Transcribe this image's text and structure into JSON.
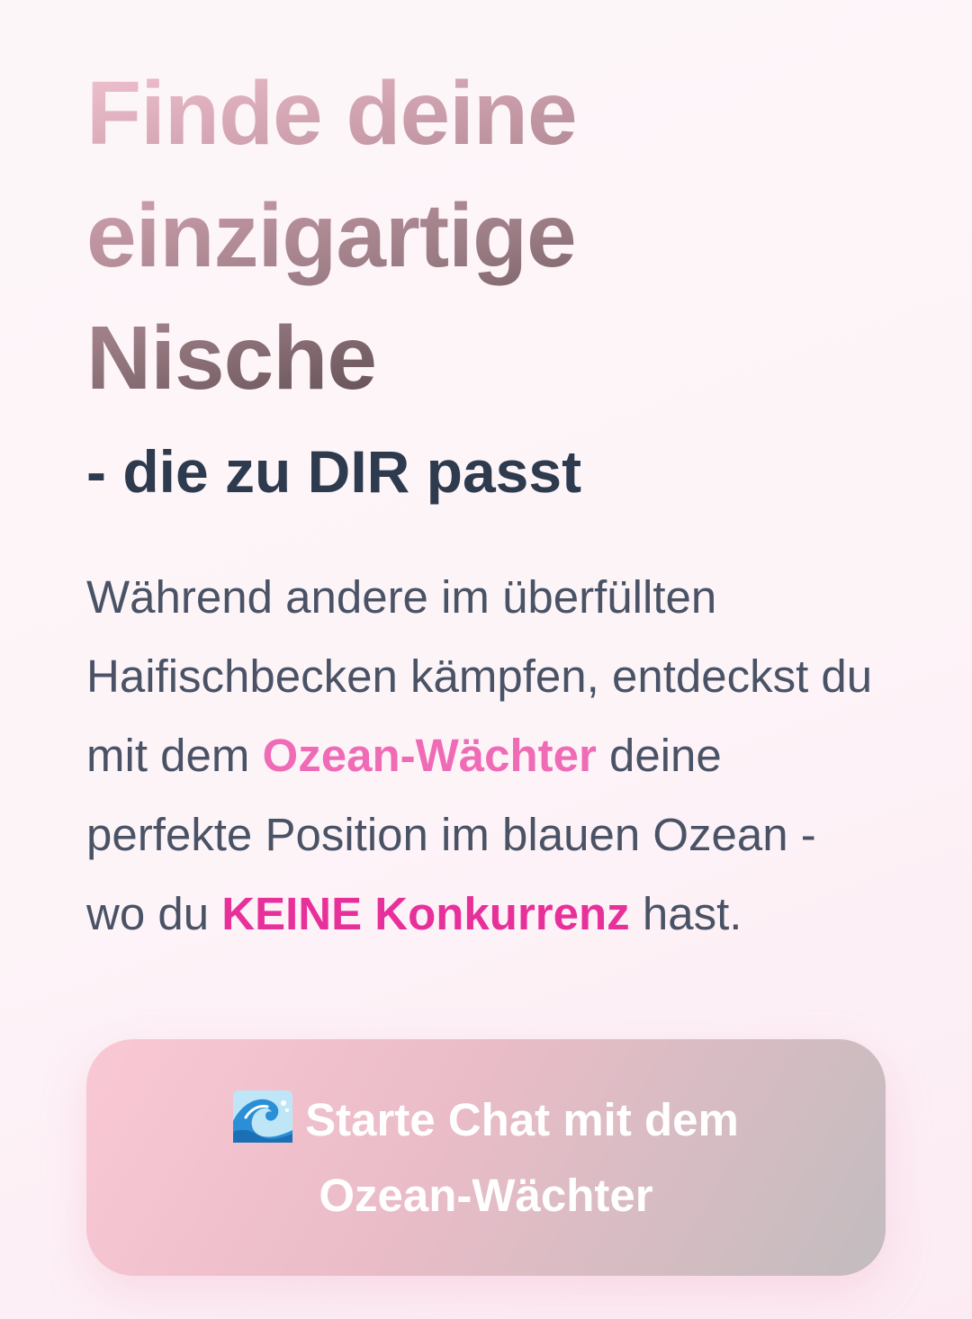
{
  "hero": {
    "headline_lines": [
      "Finde deine",
      "einzigartige",
      "Nische"
    ],
    "subheadline": "- die zu DIR passt",
    "description": {
      "part1": "Während andere im überfüllten Haifischbecken kämpfen, entdeckst du mit dem ",
      "highlight1": "Ozean-Wächter",
      "part2": " deine perfekte Position im blauen Ozean - wo du ",
      "highlight2": "KEINE Konkurrenz",
      "part3": " hast."
    }
  },
  "cta": {
    "icon": "wave-icon",
    "label": "Starte Chat mit dem Ozean-Wächter"
  },
  "colors": {
    "highlight_soft": "#f06bb6",
    "highlight_strong": "#e8309b",
    "subheadline": "#2e3a4d",
    "body_text": "#4a5366"
  }
}
